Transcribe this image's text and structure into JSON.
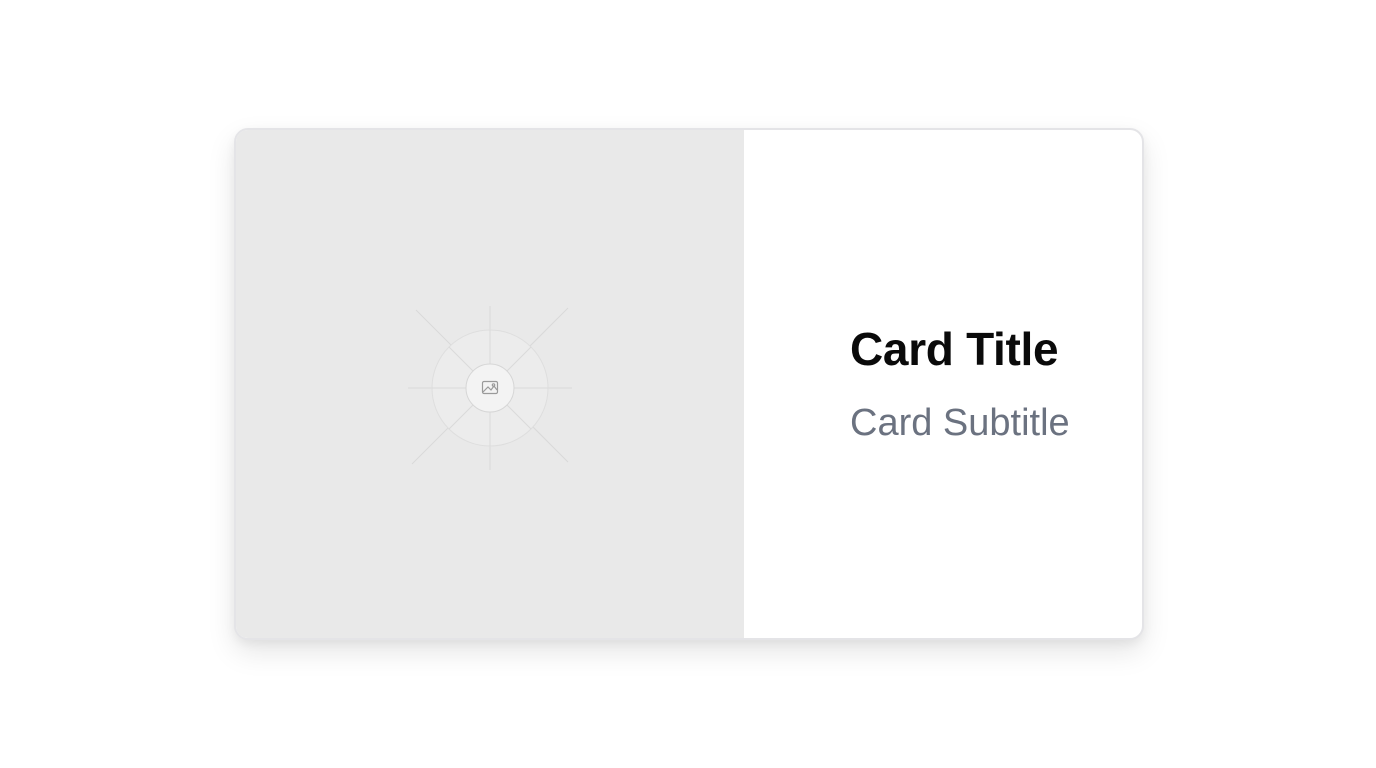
{
  "card": {
    "title": "Card Title",
    "subtitle": "Card Subtitle",
    "image": {
      "icon": "image-placeholder-icon"
    }
  },
  "colors": {
    "media_background": "#e9e9e9",
    "border": "#e4e4e7",
    "title": "#0a0a0a",
    "subtitle": "#6b7280"
  }
}
